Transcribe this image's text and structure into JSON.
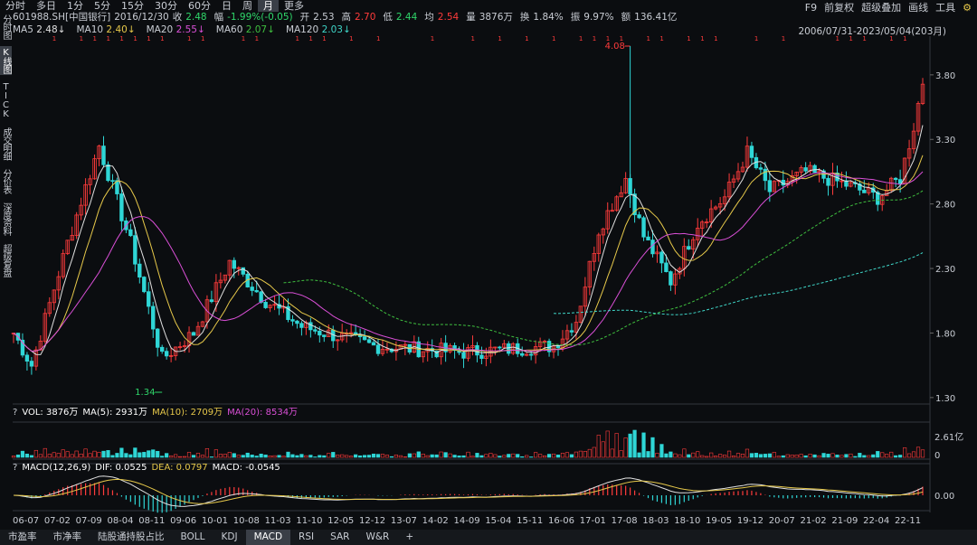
{
  "top_tabs": [
    "分时",
    "多日",
    "1分",
    "5分",
    "15分",
    "30分",
    "60分",
    "日",
    "周",
    "月",
    "更多"
  ],
  "top_tabs_active": "月",
  "top_right": [
    "F9",
    "前复权",
    "超级叠加",
    "画线",
    "工具"
  ],
  "info": {
    "code": "601988.SH[中国银行]",
    "date": "2016/12/30",
    "close_label": "收",
    "close": "2.48",
    "chg_label": "幅",
    "chg": "-1.99%(-0.05)",
    "open_label": "开",
    "open": "2.53",
    "high_label": "高",
    "high": "2.70",
    "low_label": "低",
    "low": "2.44",
    "avg_label": "均",
    "avg": "2.54",
    "vol_label": "量",
    "vol": "3876万",
    "turn_label": "换",
    "turn": "1.84%",
    "amp_label": "振",
    "amp": "9.97%",
    "amt_label": "额",
    "amt": "136.41亿"
  },
  "ma": [
    {
      "label": "MA5",
      "value": "2.48",
      "color": "#e0e0e0"
    },
    {
      "label": "MA10",
      "value": "2.40",
      "color": "#e6c84a"
    },
    {
      "label": "MA20",
      "value": "2.55",
      "color": "#d94fd6"
    },
    {
      "label": "MA60",
      "value": "2.07",
      "color": "#3fbf3f"
    },
    {
      "label": "MA120",
      "value": "2.03",
      "color": "#3fd6c8"
    }
  ],
  "range_text": "2006/07/31-2023/05/04(203月)",
  "sidebar": [
    "分时图",
    "K线图",
    "TICK",
    "成交明细",
    "分价表",
    "深度资料",
    "超级复盘"
  ],
  "sidebar_active": "K线图",
  "y_labels": [
    "3.80",
    "3.30",
    "2.80",
    "2.30",
    "1.80",
    "1.30"
  ],
  "marks": {
    "high": "4.08",
    "low": "1.34"
  },
  "vol": {
    "q": "?",
    "vol": "VOL: 3876万",
    "ma5": "MA(5): 2931万",
    "ma10": "MA(10): 2709万",
    "ma20": "MA(20): 8534万",
    "y_top": "2.61亿",
    "y_bottom": "0"
  },
  "macd": {
    "q": "?",
    "title": "MACD(12,26,9)",
    "dif": "DIF: 0.0525",
    "dea": "DEA: 0.0797",
    "macd": "MACD: -0.0545",
    "y_label": "0.00"
  },
  "dates": [
    "06-07",
    "07-02",
    "07-09",
    "08-04",
    "08-11",
    "09-06",
    "10-01",
    "10-08",
    "11-03",
    "11-10",
    "12-05",
    "12-12",
    "13-07",
    "14-02",
    "14-09",
    "15-04",
    "15-11",
    "16-06",
    "17-01",
    "17-08",
    "18-03",
    "18-10",
    "19-05",
    "19-12",
    "20-07",
    "21-02",
    "21-09",
    "22-04",
    "22-11"
  ],
  "bottom_tabs": [
    "市盈率",
    "市净率",
    "陆股通持股占比",
    "BOLL",
    "KDJ",
    "MACD",
    "RSI",
    "SAR",
    "W&R",
    "+"
  ],
  "bottom_active": "MACD",
  "colors": {
    "up": "#ff3b3b",
    "down": "#2fd6d6",
    "grid": "#2a2d33",
    "bg": "#0b0d10"
  }
}
